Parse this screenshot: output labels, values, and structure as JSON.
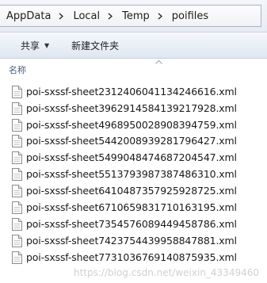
{
  "breadcrumb": [
    "AppData",
    "Local",
    "Temp",
    "poifiles"
  ],
  "toolbar": {
    "share_label": "共享",
    "new_folder_label": "新建文件夹"
  },
  "columns": {
    "name_label": "名称"
  },
  "files": [
    "poi-sxssf-sheet2312406041134246616.xml",
    "poi-sxssf-sheet3962914584139217928.xml",
    "poi-sxssf-sheet4968950028908394759.xml",
    "poi-sxssf-sheet5442008939281796427.xml",
    "poi-sxssf-sheet5499048474687204547.xml",
    "poi-sxssf-sheet5513793987387486310.xml",
    "poi-sxssf-sheet6410487357925928725.xml",
    "poi-sxssf-sheet6710659831710163195.xml",
    "poi-sxssf-sheet7354576089449458786.xml",
    "poi-sxssf-sheet7423754439958847881.xml",
    "poi-sxssf-sheet7731036769140875935.xml"
  ],
  "watermark": "https://blog.csdn.net/weixin_43349460"
}
